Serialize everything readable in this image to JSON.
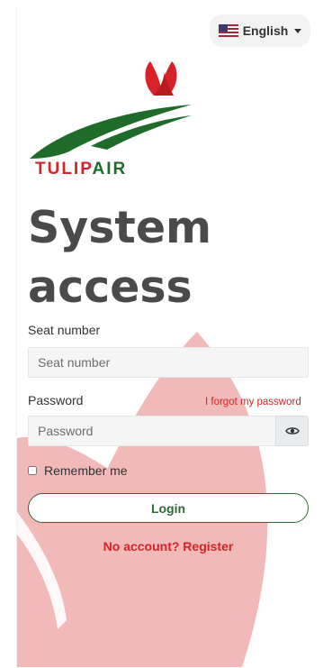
{
  "language": {
    "selected": "English",
    "flag_icon": "us-flag-icon"
  },
  "brand": {
    "name_part1": "TULIP",
    "name_part2": "AIR",
    "red": "#d72229",
    "green": "#1f6b2a"
  },
  "title": "System access",
  "form": {
    "seat_label": "Seat number",
    "seat_placeholder": "Seat number",
    "password_label": "Password",
    "password_placeholder": "Password",
    "forgot_link": "I forgot my password",
    "remember_label": "Remember me",
    "remember_checked": false,
    "login_button": "Login",
    "register_link": "No account? Register"
  },
  "colors": {
    "accent_red": "#d72229",
    "accent_green": "#2e6b35",
    "bg_tulip": "#f2b9b9"
  }
}
